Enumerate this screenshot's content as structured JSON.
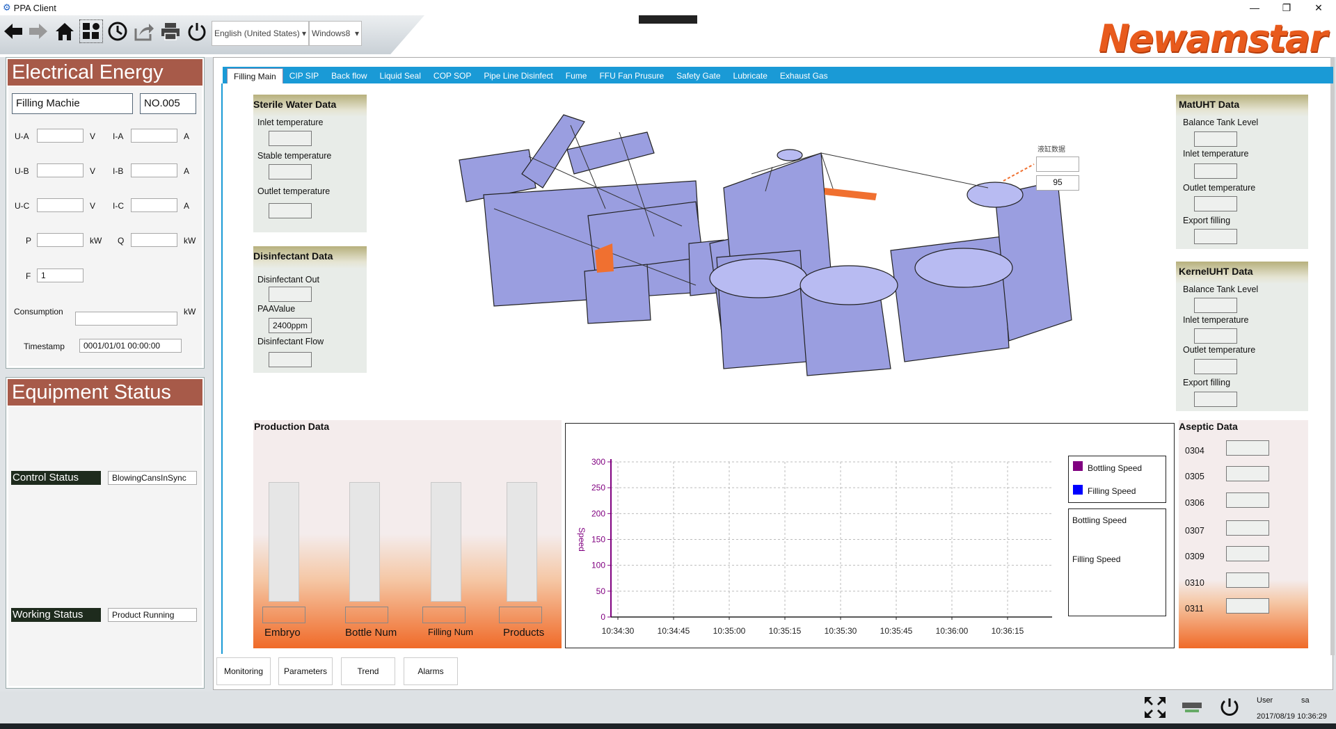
{
  "window": {
    "title": "PPA Client",
    "minimize": "—",
    "restore": "❐",
    "close": "✕"
  },
  "toolbar": {
    "language": "English (United States)",
    "theme": "Windows8",
    "brand": "Newamstar"
  },
  "electrical": {
    "title": "Electrical Energy",
    "machine": "Filling Machie",
    "number": "NO.005",
    "ua_label": "U-A",
    "ub_label": "U-B",
    "uc_label": "U-C",
    "ia_label": "I-A",
    "ib_label": "I-B",
    "ic_label": "I-C",
    "v": "V",
    "a": "A",
    "p_label": "P",
    "q_label": "Q",
    "kw": "kW",
    "f_label": "F",
    "f_value": "1",
    "consumption_label": "Consumption",
    "consumption_unit": "kW",
    "timestamp_label": "Timestamp",
    "timestamp_value": "0001/01/01 00:00:00"
  },
  "equipment": {
    "title": "Equipment Status",
    "control_label": "Control Status",
    "control_value": "BlowingCansInSync",
    "working_label": "Working Status",
    "working_value": "Product Running"
  },
  "tabs": [
    "Filling Main",
    "CIP SIP",
    "Back flow",
    "Liquid Seal",
    "COP SOP",
    "Pipe Line Disinfect",
    "Fume",
    "FFU Fan Prusure",
    "Safety Gate",
    "Lubricate",
    "Exhaust Gas"
  ],
  "sterile": {
    "title": "Sterile Water Data",
    "inlet": "Inlet temperature",
    "stable": "Stable temperature",
    "outlet": "Outlet temperature"
  },
  "disinfectant": {
    "title": "Disinfectant Data",
    "out": "Disinfectant Out",
    "paa": "PAAValue",
    "paa_value": "2400ppm",
    "flow": "Disinfectant Flow"
  },
  "matuht": {
    "title": "MatUHT Data",
    "balance": "Balance Tank Level",
    "inlet": "Inlet temperature",
    "outlet": "Outlet temperature",
    "export": "Export filling"
  },
  "kerneluht": {
    "title": "KernelUHT Data",
    "balance": "Balance Tank Level",
    "inlet": "Inlet temperature",
    "outlet": "Outlet temperature",
    "export": "Export filling"
  },
  "cylinder": {
    "label": "液缸数据",
    "value": "95"
  },
  "production": {
    "title": "Production Data",
    "bars": [
      "Embryo",
      "Bottle Num",
      "Filling Num",
      "Products"
    ]
  },
  "chart_data": {
    "type": "line",
    "ylabel": "Speed",
    "ylim": [
      0,
      300
    ],
    "yticks": [
      "0",
      "50",
      "100",
      "150",
      "200",
      "250",
      "300"
    ],
    "xticks": [
      "10:34:30",
      "10:34:45",
      "10:35:00",
      "10:35:15",
      "10:35:30",
      "10:35:45",
      "10:36:00",
      "10:36:15"
    ],
    "series": [
      {
        "name": "Bottling Speed",
        "color": "#800080",
        "values": []
      },
      {
        "name": "Filling Speed",
        "color": "#0000ff",
        "values": []
      }
    ],
    "legend_position": "right",
    "readout": [
      "Bottling Speed",
      "Filling Speed"
    ]
  },
  "aseptic": {
    "title": "Aseptic Data",
    "items": [
      "0304",
      "0305",
      "0306",
      "0307",
      "0309",
      "0310",
      "0311"
    ]
  },
  "bottomnav": [
    "Monitoring",
    "Parameters",
    "Trend",
    "Alarms"
  ],
  "status": {
    "user_label": "User",
    "user": "sa",
    "datetime": "2017/08/19 10:36:29"
  }
}
